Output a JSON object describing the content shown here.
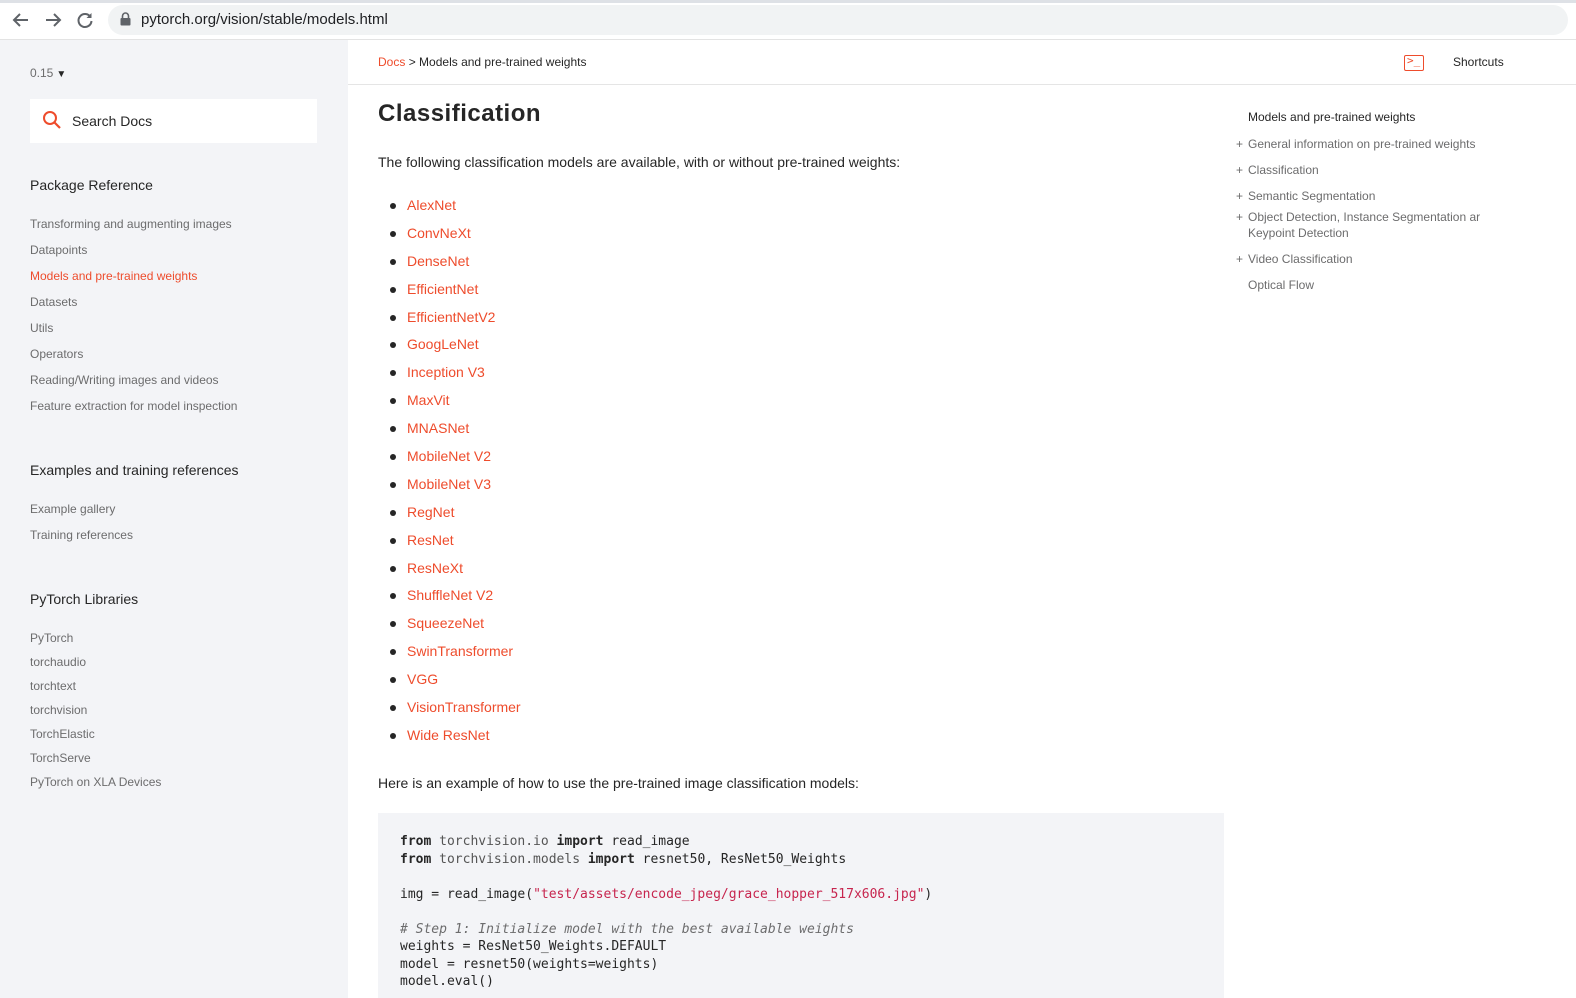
{
  "browser": {
    "url": "pytorch.org/vision/stable/models.html"
  },
  "sidebar": {
    "version": "0.15",
    "search_placeholder": "Search Docs",
    "package_heading": "Package Reference",
    "package_items": [
      "Transforming and augmenting images",
      "Datapoints",
      "Models and pre-trained weights",
      "Datasets",
      "Utils",
      "Operators",
      "Reading/Writing images and videos",
      "Feature extraction for model inspection"
    ],
    "examples_heading": "Examples and training references",
    "examples_items": [
      "Example gallery",
      "Training references"
    ],
    "libraries_heading": "PyTorch Libraries",
    "libraries_items": [
      "PyTorch",
      "torchaudio",
      "torchtext",
      "torchvision",
      "TorchElastic",
      "TorchServe",
      "PyTorch on XLA Devices"
    ]
  },
  "breadcrumb": {
    "root": "Docs",
    "separator": ">",
    "current": "Models and pre-trained weights"
  },
  "main": {
    "title": "Classification",
    "intro": "The following classification models are available, with or without pre-trained weights:",
    "models": [
      "AlexNet",
      "ConvNeXt",
      "DenseNet",
      "EfficientNet",
      "EfficientNetV2",
      "GoogLeNet",
      "Inception V3",
      "MaxVit",
      "MNASNet",
      "MobileNet V2",
      "MobileNet V3",
      "RegNet",
      "ResNet",
      "ResNeXt",
      "ShuffleNet V2",
      "SqueezeNet",
      "SwinTransformer",
      "VGG",
      "VisionTransformer",
      "Wide ResNet"
    ],
    "example_text": "Here is an example of how to use the pre-trained image classification models:",
    "code": {
      "l1_from": "from",
      "l1_mod": "torchvision.io",
      "l1_import": "import",
      "l1_rest": "read_image",
      "l2_from": "from",
      "l2_mod": "torchvision.models",
      "l2_import": "import",
      "l2_rest": "resnet50, ResNet50_Weights",
      "l3_pre": "img = read_image(",
      "l3_str": "\"test/assets/encode_jpeg/grace_hopper_517x606.jpg\"",
      "l3_post": ")",
      "l4_comment": "# Step 1: Initialize model with the best available weights",
      "l5": "weights = ResNet50_Weights.DEFAULT",
      "l6": "model = resnet50(weights=weights)",
      "l7": "model.eval()"
    }
  },
  "toc": {
    "shortcuts_label": "Shortcuts",
    "title": "Models and pre-trained weights",
    "items": [
      {
        "plus": "+",
        "label": "General information on pre-trained weights"
      },
      {
        "plus": "+",
        "label": "Classification"
      },
      {
        "plus": "+",
        "label": "Semantic Segmentation"
      },
      {
        "plus": "+",
        "label": "Object Detection, Instance Segmentation ar Keypoint Detection"
      },
      {
        "plus": "+",
        "label": "Video Classification"
      },
      {
        "plus": "",
        "label": "Optical Flow"
      }
    ]
  },
  "colors": {
    "accent": "#ee4c2c",
    "sidebar_bg": "#f3f4f7",
    "code_bg": "#f3f4f7"
  },
  "icons": [
    "back-arrow-icon",
    "forward-arrow-icon",
    "reload-icon",
    "lock-icon",
    "search-icon",
    "shortcuts-terminal-icon",
    "caret-down-icon"
  ]
}
